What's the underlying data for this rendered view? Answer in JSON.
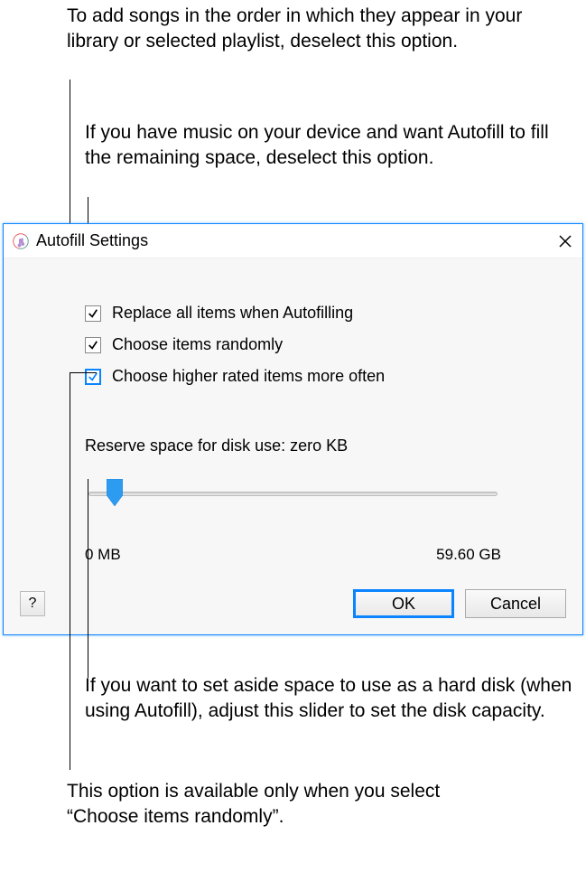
{
  "callouts": {
    "c1": "To add songs in the order in which they appear in your library or selected playlist, deselect this option.",
    "c2": "If you have music on your device and want Autofill to fill the remaining space, deselect this option.",
    "c3": "If you want to set aside space to use as a hard disk (when using Autofill), adjust this slider to set the disk capacity.",
    "c4": "This option is available only when you select “Choose items randomly”."
  },
  "window": {
    "title": "Autofill Settings",
    "options": {
      "replace_all": "Replace all items when Autofilling",
      "choose_random": "Choose items randomly",
      "higher_rated": "Choose higher rated items more often"
    },
    "reserve": {
      "label": "Reserve space for disk use: zero KB",
      "min": "0 MB",
      "max": "59.60 GB"
    },
    "buttons": {
      "help": "?",
      "ok": "OK",
      "cancel": "Cancel"
    }
  }
}
